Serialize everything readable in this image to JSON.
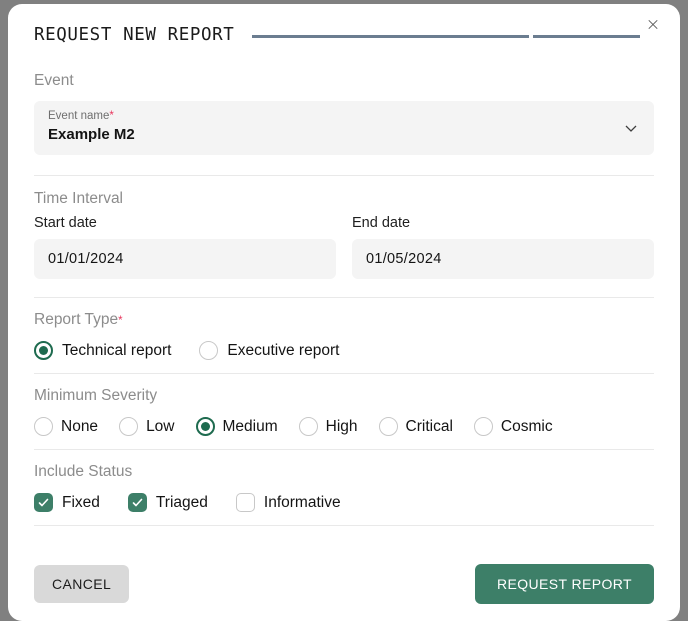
{
  "dialog": {
    "title": "REQUEST NEW REPORT",
    "close_icon": "close-icon",
    "accent_green": "#3d7f68",
    "radio_green": "#1e6b4f",
    "required_star_color": "#e8365d",
    "rule_color": "#6b7d90"
  },
  "event_section": {
    "label": "Event",
    "field": {
      "caption": "Event name",
      "required_marker": "*",
      "value": "Example M2",
      "chevron_icon": "chevron-down-icon"
    }
  },
  "time_interval": {
    "label": "Time Interval",
    "start": {
      "label": "Start date",
      "value": "01/01/2024"
    },
    "end": {
      "label": "End date",
      "value": "01/05/2024"
    }
  },
  "report_type": {
    "label": "Report Type",
    "required_marker": "*",
    "options": [
      {
        "label": "Technical report",
        "checked": true
      },
      {
        "label": "Executive report",
        "checked": false
      }
    ]
  },
  "minimum_severity": {
    "label": "Minimum Severity",
    "options": [
      {
        "label": "None",
        "checked": false
      },
      {
        "label": "Low",
        "checked": false
      },
      {
        "label": "Medium",
        "checked": true
      },
      {
        "label": "High",
        "checked": false
      },
      {
        "label": "Critical",
        "checked": false
      },
      {
        "label": "Cosmic",
        "checked": false
      }
    ]
  },
  "include_status": {
    "label": "Include Status",
    "options": [
      {
        "label": "Fixed",
        "checked": true
      },
      {
        "label": "Triaged",
        "checked": true
      },
      {
        "label": "Informative",
        "checked": false
      }
    ]
  },
  "footer": {
    "cancel_label": "CANCEL",
    "submit_label": "REQUEST REPORT"
  }
}
